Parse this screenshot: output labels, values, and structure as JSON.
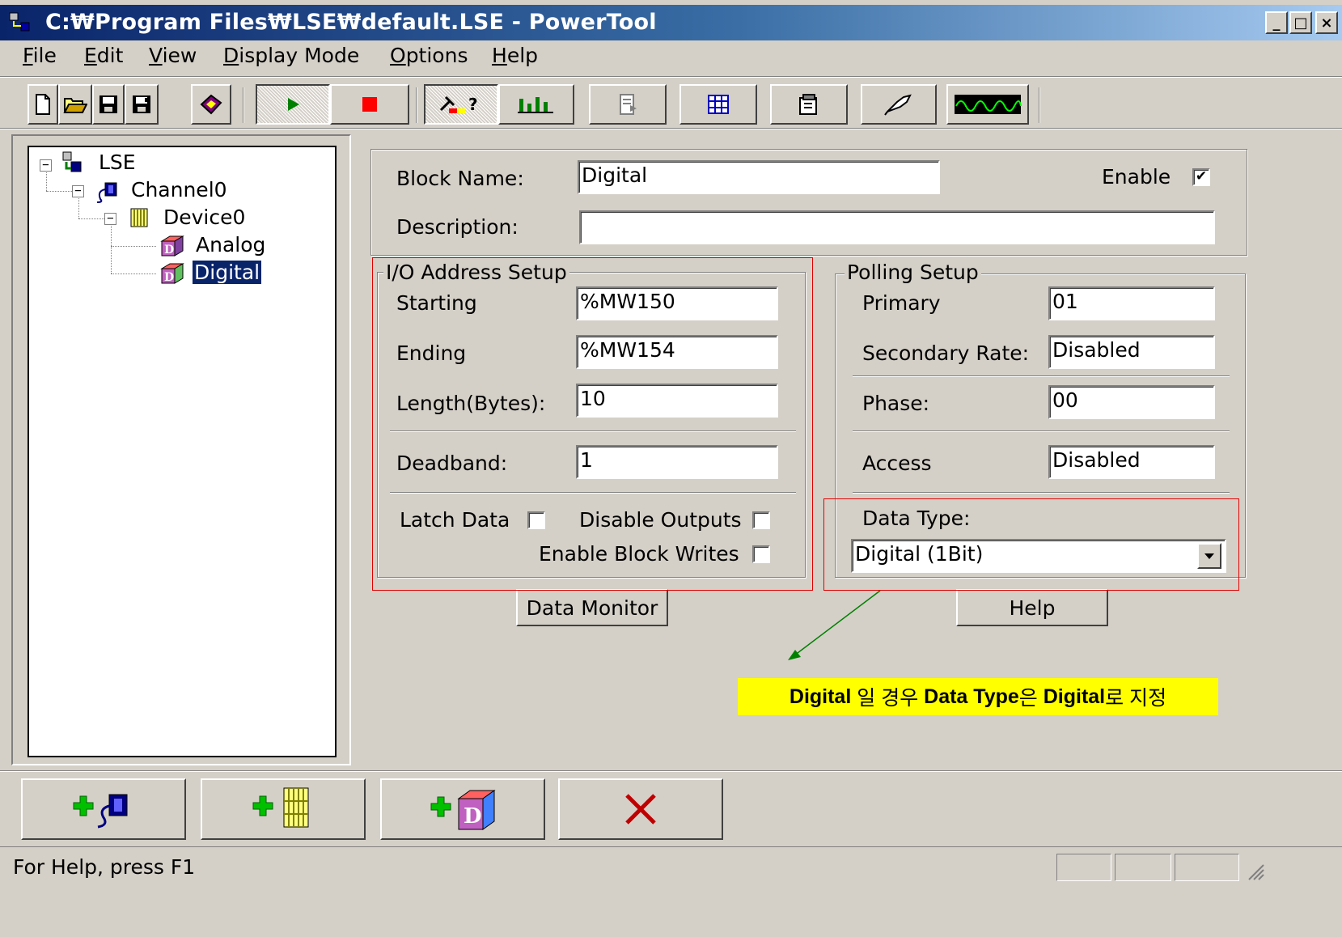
{
  "window": {
    "title": "C:₩Program Files₩LSE₩default.LSE - PowerTool",
    "controls": {
      "minimize": "_",
      "maximize": "□",
      "close": "×"
    }
  },
  "menu": [
    {
      "label": "File",
      "accel": "F",
      "rest": "ile"
    },
    {
      "label": "Edit",
      "accel": "E",
      "rest": "dit"
    },
    {
      "label": "View",
      "accel": "V",
      "rest": "iew"
    },
    {
      "label": "Display Mode",
      "accel": "D",
      "rest": "isplay Mode"
    },
    {
      "label": "Options",
      "accel": "O",
      "rest": "ptions"
    },
    {
      "label": "Help",
      "accel": "H",
      "rest": "elp"
    }
  ],
  "toolbar": {
    "buttons": [
      "new-file-icon",
      "open-folder-icon",
      "save-icon",
      "save-as-icon",
      "book-icon",
      "run-icon",
      "stop-icon",
      "tools-help-icon",
      "bar-chart-icon",
      "import-icon",
      "network-grid-icon",
      "properties-icon",
      "probe-icon",
      "waveform-icon"
    ],
    "run_pressed": true
  },
  "tree": {
    "root": "LSE",
    "channel": "Channel0",
    "device": "Device0",
    "blocks": [
      "Analog",
      "Digital"
    ],
    "selected": "Digital"
  },
  "form": {
    "block_name_label": "Block Name:",
    "block_name": "Digital",
    "enable_label": "Enable",
    "enable_checked": true,
    "description_label": "Description:",
    "description": "",
    "io": {
      "title": "I/O Address Setup",
      "starting_label": "Starting",
      "starting": "%MW150",
      "ending_label": "Ending",
      "ending": "%MW154",
      "length_label": "Length(Bytes):",
      "length": "10",
      "deadband_label": "Deadband:",
      "deadband": "1",
      "latch_label": "Latch Data",
      "disable_outputs_label": "Disable Outputs",
      "enable_block_writes_label": "Enable Block Writes"
    },
    "polling": {
      "title": "Polling Setup",
      "primary_label": "Primary",
      "primary": "01",
      "secondary_label": "Secondary Rate:",
      "secondary": "Disabled",
      "phase_label": "Phase:",
      "phase": "00",
      "access_label": "Access",
      "access": "Disabled",
      "data_type_label": "Data Type:",
      "data_type": "Digital (1Bit)"
    },
    "data_monitor_button": "Data Monitor",
    "help_button": "Help"
  },
  "annotation": {
    "p1_bold": "Digital",
    "p2": " 일 경우 ",
    "p3_bold": "Data Type",
    "p4": "은 ",
    "p5_bold": "Digital",
    "p6": "로 지정"
  },
  "bottom_buttons": [
    "add-channel-icon",
    "add-device-icon",
    "add-block-icon",
    "delete-icon"
  ],
  "status": {
    "text": "For Help, press F1"
  },
  "colors": {
    "face": "#d4d0c8",
    "title_start": "#0a246a",
    "title_end": "#a6caf0",
    "selection": "#0a246a",
    "annotation_bg": "#ffff00",
    "annotation_box": "#e00000",
    "arrow": "#008000"
  }
}
